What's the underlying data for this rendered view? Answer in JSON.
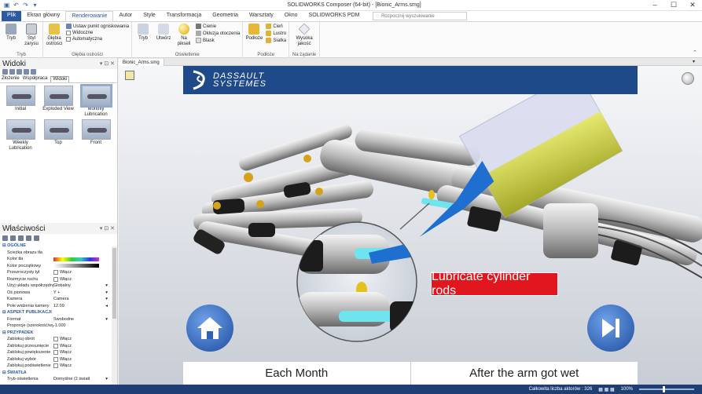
{
  "window": {
    "title": "SOLIDWORKS Composer (64-bit) - [Bionic_Arms.smg]"
  },
  "ribbon_tabs": [
    {
      "label": "Plik",
      "style": "file"
    },
    {
      "label": "Ekran główny"
    },
    {
      "label": "Renderowanie",
      "style": "active"
    },
    {
      "label": "Autor"
    },
    {
      "label": "Style"
    },
    {
      "label": "Transformacja"
    },
    {
      "label": "Geometria"
    },
    {
      "label": "Warsztaty"
    },
    {
      "label": "Okno"
    },
    {
      "label": "SOLIDWORKS PDM"
    }
  ],
  "search": {
    "placeholder": "Rozpocznij wyszukiwanie"
  },
  "ribbon": {
    "tryb_group": {
      "label": "Tryb",
      "btn_tryb": "Tryb",
      "btn_style": "Styl zarysu"
    },
    "glebia_group": {
      "label": "Głębia ostrości",
      "btn_glebia": "Głębia ostrości",
      "opt_focus": "Ustaw punkt ogniskowania",
      "opt_visible": "Widoczne",
      "opt_auto": "Automatyczna"
    },
    "oswietlenie_group": {
      "label": "Oświetlenie",
      "btn_tryb": "Tryb",
      "btn_utworz": "Utwórz",
      "btn_na_pikseli": "Na pikseli",
      "opt_cienie": "Cienie",
      "opt_okluzja": "Okluzja otoczenia",
      "opt_blask": "Blask"
    },
    "podloze_group": {
      "label": "Podłoże",
      "btn_podloze": "Podłoże",
      "opt_cien": "Cień",
      "opt_lustro": "Lustro",
      "opt_siatka": "Siatka"
    },
    "zadanie_group": {
      "label": "Na żądanie",
      "btn_jakosc": "Wysoka jakość"
    }
  },
  "views_panel": {
    "title": "Widoki",
    "tabs": [
      "Złożenie",
      "Współpraca",
      "Widoki"
    ],
    "thumbnails": [
      {
        "label": "Initial"
      },
      {
        "label": "Exploded View"
      },
      {
        "label": "Monthly Lubrication",
        "selected": true
      },
      {
        "label": "Weekly Lubrication"
      },
      {
        "label": "Top"
      },
      {
        "label": "Front"
      }
    ]
  },
  "properties_panel": {
    "title": "Właściwości",
    "rows": [
      {
        "section": "OGÓLNE"
      },
      {
        "key": "Ścieżka obrazu tła",
        "value": ""
      },
      {
        "key": "Kolor tła",
        "value": "",
        "kind": "gradient"
      },
      {
        "key": "Kolor początkowy",
        "value": "",
        "kind": "gradient2"
      },
      {
        "key": "Przezroczysty tył",
        "value": "Włącz",
        "kind": "check"
      },
      {
        "key": "Rozmycie ruchu",
        "value": "Włącz",
        "kind": "check"
      },
      {
        "key": "Użyj układu współrzędnych",
        "value": "Globalny",
        "kind": "select"
      },
      {
        "key": "Oś pionowa",
        "value": "Y +",
        "kind": "select"
      },
      {
        "key": "Kamera",
        "value": "Camera",
        "kind": "select"
      },
      {
        "key": "Pole widzenia kamery",
        "value": "12.09",
        "kind": "slider"
      },
      {
        "section": "ASPEKT PUBLIKACJI"
      },
      {
        "key": "Format",
        "value": "Swobodne",
        "kind": "select"
      },
      {
        "key": "Proporcje (szerokość/wys...",
        "value": "-1.000"
      },
      {
        "section": "PRZYPADEK"
      },
      {
        "key": "Zablokuj obrót",
        "value": "Włącz",
        "kind": "check"
      },
      {
        "key": "Zablokuj przesunięcie",
        "value": "Włącz",
        "kind": "check"
      },
      {
        "key": "Zablokuj powiększenie",
        "value": "Włącz",
        "kind": "check"
      },
      {
        "key": "Zablokuj wybór",
        "value": "Włącz",
        "kind": "check"
      },
      {
        "key": "Zablokuj podświetlenie",
        "value": "Włącz",
        "kind": "check"
      },
      {
        "section": "ŚWIATŁA"
      },
      {
        "key": "Tryb oświetlenia",
        "value": "Domyślne (2 światł",
        "kind": "select"
      }
    ]
  },
  "document": {
    "tab_label": "Bionic_Arms.smg"
  },
  "viewport": {
    "banner_line1": "DASSAULT",
    "banner_line2": "SYSTEMES",
    "callout_text": "Lubricate cylinder rods",
    "caption_left": "Each Month",
    "caption_right": "After the arm got wet",
    "home_button": "home-icon",
    "next_button": "play-next-icon"
  },
  "status_bar": {
    "actors_label": "Całkowita liczba aktorów : 326",
    "zoom": "100%"
  },
  "colors": {
    "accent": "#2b5aa3",
    "banner": "#1e4a8a",
    "callout": "#e1161f",
    "status": "#1f3e73"
  }
}
